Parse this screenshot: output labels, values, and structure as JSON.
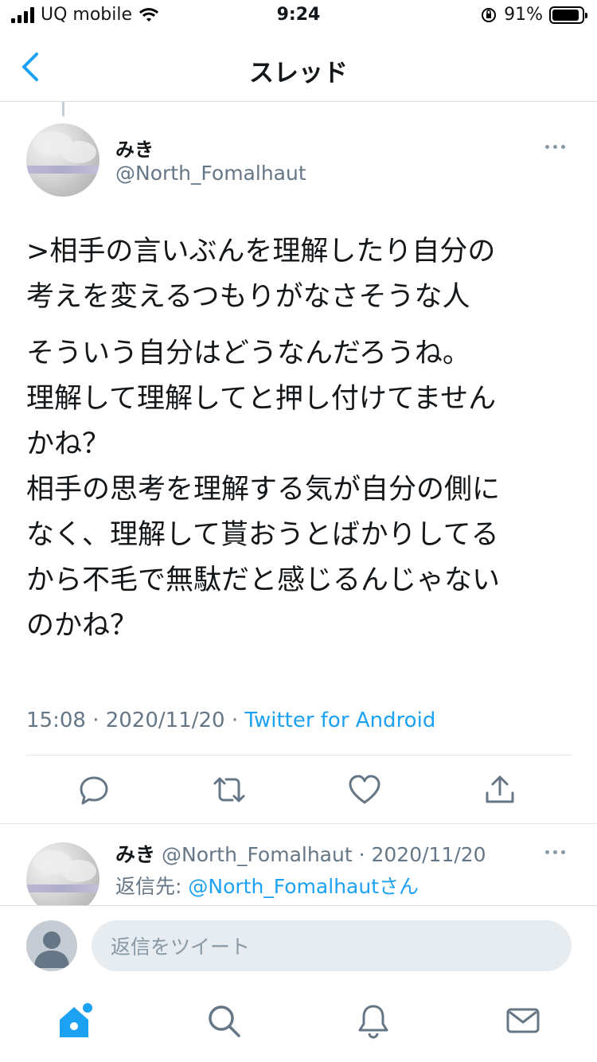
{
  "status_bar": {
    "carrier": "UQ mobile",
    "time": "9:24",
    "battery": "91%",
    "battery_fraction": 0.91
  },
  "header": {
    "title": "スレッド"
  },
  "tweet": {
    "author_name": "みき",
    "author_handle": "@North_Fomalhaut",
    "paragraphs": [
      ">相手の言いぶんを理解したり自分の\n考えを変えるつもりがなさそうな人",
      "そういう自分はどうなんだろうね。\n理解して理解してと押し付けてません\nかね？\n相手の思考を理解する気が自分の側に\nなく、理解して貰おうとばかりしてる\nから不毛で無駄だと感じるんじゃない\nのかね？"
    ],
    "timestamp": "15:08 · 2020/11/20 · ",
    "source": "Twitter for Android"
  },
  "reply": {
    "author_name": "みき",
    "handle_date": "@North_Fomalhaut · 2020/11/20",
    "reply_prefix": "返信先: ",
    "reply_mention": "@North_Fomalhautさん"
  },
  "compose": {
    "placeholder": "返信をツイート"
  },
  "icons": {
    "back": "chevron-left-icon",
    "more": "more-horizontal-icon",
    "reply": "comment-icon",
    "retweet": "retweet-icon",
    "like": "heart-icon",
    "share": "share-icon",
    "home": "home-icon",
    "search": "search-icon",
    "notifications": "bell-icon",
    "messages": "mail-icon"
  },
  "colors": {
    "accent": "#1da1f2",
    "muted": "#657786"
  }
}
